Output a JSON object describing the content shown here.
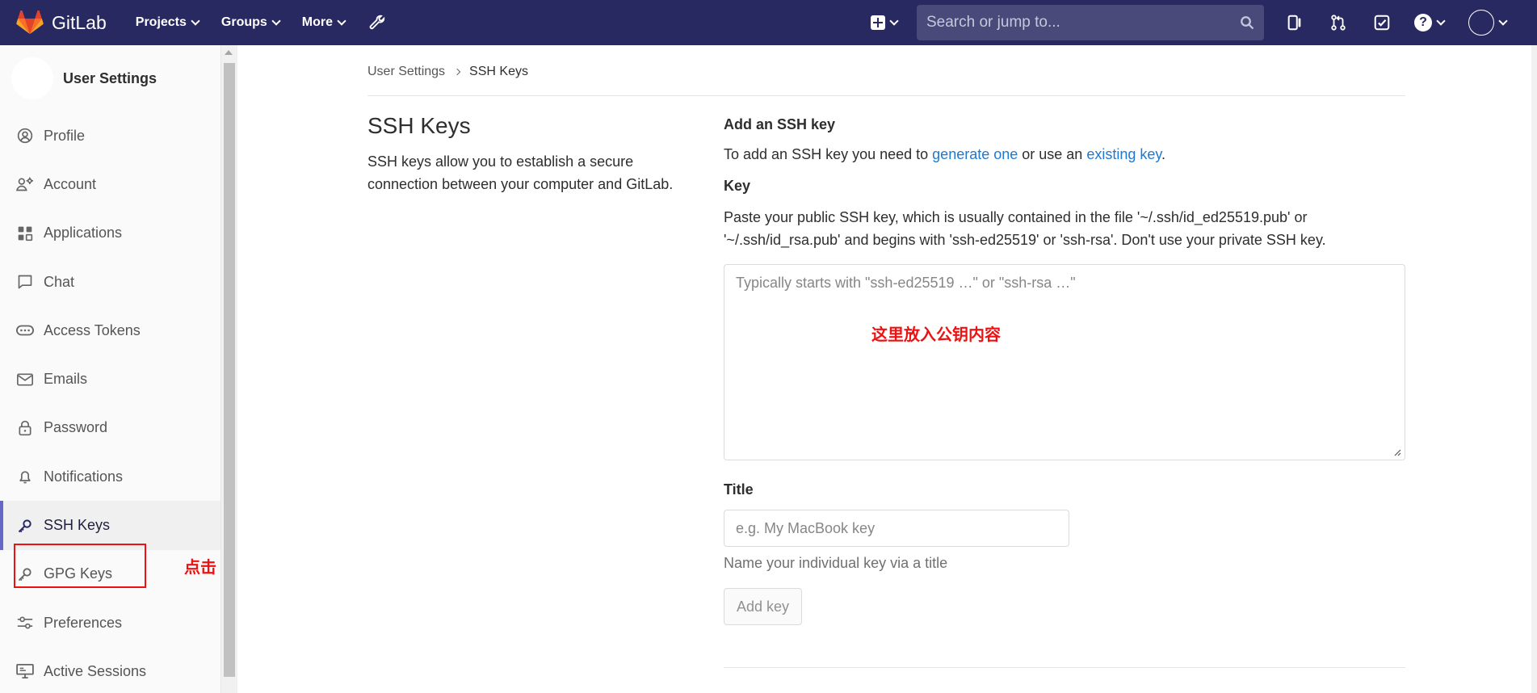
{
  "navbar": {
    "brand_name": "GitLab",
    "menu": [
      {
        "label": "Projects"
      },
      {
        "label": "Groups"
      },
      {
        "label": "More"
      }
    ],
    "search_placeholder": "Search or jump to...",
    "colors": {
      "background": "#292961",
      "search_bg": "#4a4a7a"
    }
  },
  "sidebar": {
    "title": "User Settings",
    "items": [
      {
        "label": "Profile",
        "icon": "profile-icon"
      },
      {
        "label": "Account",
        "icon": "account-icon"
      },
      {
        "label": "Applications",
        "icon": "applications-icon"
      },
      {
        "label": "Chat",
        "icon": "chat-icon"
      },
      {
        "label": "Access Tokens",
        "icon": "access-tokens-icon"
      },
      {
        "label": "Emails",
        "icon": "emails-icon"
      },
      {
        "label": "Password",
        "icon": "lock-icon"
      },
      {
        "label": "Notifications",
        "icon": "bell-icon"
      },
      {
        "label": "SSH Keys",
        "icon": "key-icon",
        "active": true
      },
      {
        "label": "GPG Keys",
        "icon": "key-icon"
      },
      {
        "label": "Preferences",
        "icon": "preferences-icon"
      },
      {
        "label": "Active Sessions",
        "icon": "monitor-icon"
      }
    ],
    "annotation_click": "点击"
  },
  "breadcrumb": {
    "parent": "User Settings",
    "current": "SSH Keys"
  },
  "content": {
    "page_title": "SSH Keys",
    "page_description": "SSH keys allow you to establish a secure connection between your computer and GitLab.",
    "add_heading": "Add an SSH key",
    "intro_prefix": "To add an SSH key you need to ",
    "intro_link1": "generate one",
    "intro_middle": " or use an ",
    "intro_link2": "existing key",
    "intro_suffix": ".",
    "key_label": "Key",
    "key_help": "Paste your public SSH key, which is usually contained in the file '~/.ssh/id_ed25519.pub' or '~/.ssh/id_rsa.pub' and begins with 'ssh-ed25519' or 'ssh-rsa'. Don't use your private SSH key.",
    "key_placeholder": "Typically starts with \"ssh-ed25519 …\" or \"ssh-rsa …\"",
    "key_annotation": "这里放入公钥内容",
    "title_label": "Title",
    "title_placeholder": "e.g. My MacBook key",
    "title_help": "Name your individual key via a title",
    "add_button": "Add key",
    "link_color": "#1f78d1",
    "annotation_color": "#ee1111"
  }
}
